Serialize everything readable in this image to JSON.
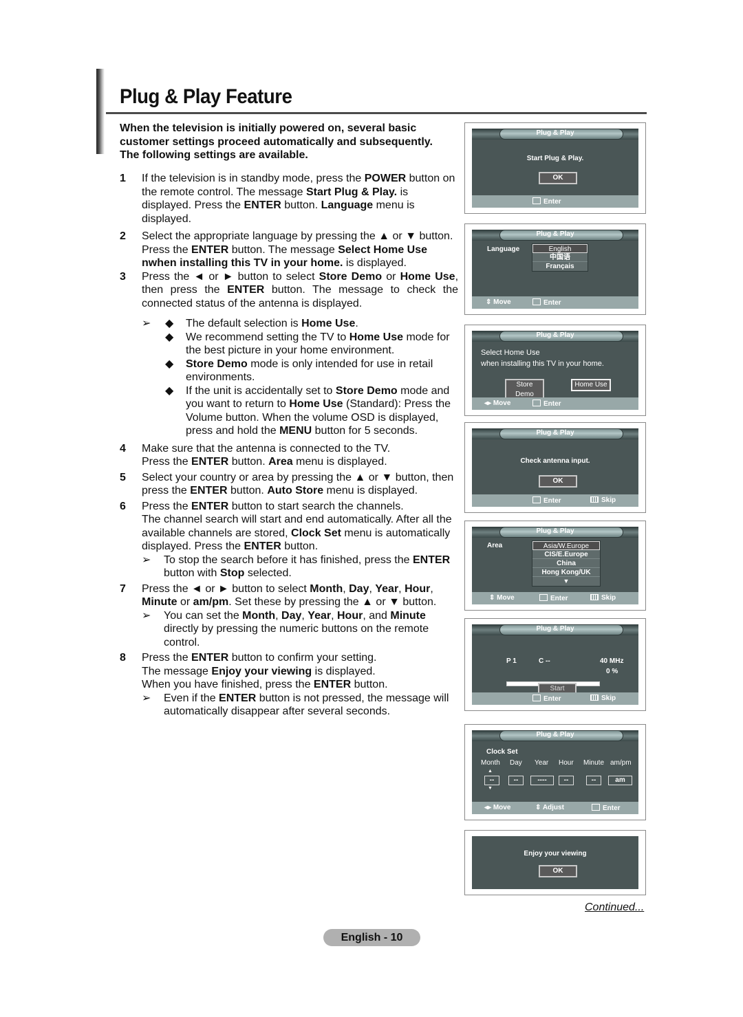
{
  "title": "Plug & Play Feature",
  "intro": "When the television is initially powered on, several basic customer settings proceed automatically and subsequently. The following settings are available.",
  "steps": [
    {
      "num": "1",
      "html": "If the television is in standby mode, press the <b>POWER</b> button on the remote control. The message <b>Start Plug &amp; Play.</b> is displayed. Press the <b>ENTER</b> button. <b>Language</b> menu is displayed."
    },
    {
      "num": "2",
      "html": "Select the appropriate language by pressing the ▲ or ▼ button. Press the <b>ENTER</b> button. The message <b>Select Home Use nwhen installing this TV in your home.</b> is displayed."
    },
    {
      "num": "3",
      "html": "Press the ◄ or ► button to select <b>Store Demo</b> or <b>Home Use</b>, then press the <b>ENTER</b> button. The message to check the connected status of the antenna is displayed."
    },
    {
      "num": "4",
      "html": "Make sure that the antenna is connected to the TV.<br>Press the <b>ENTER</b> button. <b>Area</b> menu is displayed."
    },
    {
      "num": "5",
      "html": "Select your country or area by pressing the ▲ or ▼ button, then press the <b>ENTER</b> button. <b>Auto Store</b> menu is displayed."
    },
    {
      "num": "6",
      "html": "Press the <b>ENTER</b> button to start search the channels.<br>The channel search will start and end automatically. After all the available channels are stored, <b>Clock Set</b> menu is automatically displayed. Press the <b>ENTER</b> button."
    },
    {
      "num": "7",
      "html": "Press the ◄ or ► button to select <b>Month</b>, <b>Day</b>, <b>Year</b>, <b>Hour</b>, <b>Minute</b> or <b>am/pm</b>. Set these by pressing the ▲ or ▼ button."
    },
    {
      "num": "8",
      "html": "Press the <b>ENTER</b> button to confirm your setting.<br>The message <b>Enjoy your viewing</b> is displayed.<br>When you have finished, press the <b>ENTER</b> button."
    }
  ],
  "bullets": [
    "The default selection is <b>Home Use</b>.",
    "We recommend setting the TV to <b>Home Use</b> mode for the best picture in your home environment.",
    "<b>Store Demo</b> mode is only intended for use in retail environments.",
    "If the unit is accidentally set to <b>Store Demo</b> mode and you want to return to <b>Home Use</b> (Standard): Press the Volume button. When the volume OSD is displayed, press and hold the <b>MENU</b> button for 5 seconds."
  ],
  "notes": {
    "step6": "To stop the search before it has finished, press the <b>ENTER</b> button with <b>Stop</b> selected.",
    "step7": "You can set the <b>Month</b>, <b>Day</b>, <b>Year</b>, <b>Hour</b>, and <b>Minute</b> directly by pressing the numeric buttons on the remote control.",
    "step8": "Even if the <b>ENTER</b> button is not pressed, the message will automatically disappear after several seconds."
  },
  "osd": {
    "header": "Plug & Play",
    "ok": "OK",
    "enter": "Enter",
    "move": "Move",
    "skip": "Skip",
    "adjust": "Adjust",
    "start_message": "Start Plug & Play.",
    "language": {
      "label": "Language",
      "options": [
        "English",
        "中国语",
        "Français"
      ],
      "selected": "English"
    },
    "home_use": {
      "line1": "Select Home Use",
      "line2": "when installing this TV in your home.",
      "store_demo": "Store Demo",
      "home_use": "Home Use"
    },
    "antenna": {
      "message": "Check antenna input."
    },
    "area": {
      "label": "Area",
      "options": [
        "Asia/W.Europe",
        "CIS/E.Europe",
        "China",
        "Hong Kong/UK"
      ],
      "selected": "Asia/W.Europe"
    },
    "auto_store": {
      "program": "P  1",
      "channel": "C  --",
      "frequency": "40 MHz",
      "percent_label": "0  %",
      "progress_percent": 0,
      "start": "Start"
    },
    "clock": {
      "title": "Clock Set",
      "labels": [
        "Month",
        "Day",
        "Year",
        "Hour",
        "Minute",
        "am/pm"
      ],
      "values": [
        "--",
        "--",
        "----",
        "--",
        "--",
        "am"
      ]
    },
    "enjoy": "Enjoy your viewing"
  },
  "continued": "Continued...",
  "page_number": "English - 10"
}
